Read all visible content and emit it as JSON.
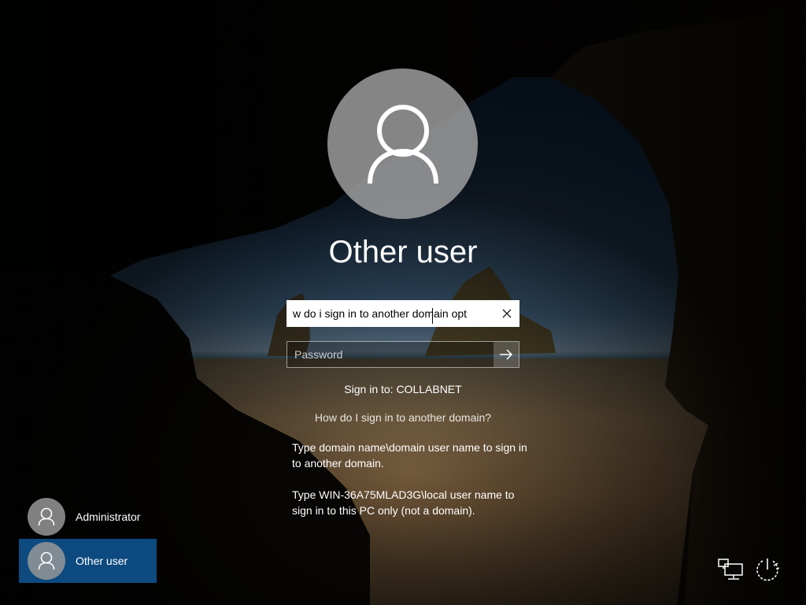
{
  "login": {
    "user_title": "Other user",
    "username_value": "w do i sign in to another domain opt",
    "password_placeholder": "Password",
    "sign_in_to": "Sign in to: COLLABNET",
    "help_link": "How do I sign in to another domain?",
    "help_text_1": "Type domain name\\domain user name to sign in to another domain.",
    "help_text_2": "Type WIN-36A75MLAD3G\\local user name to sign in to this PC only (not a domain).",
    "clear_icon": "close-icon",
    "submit_icon": "arrow-right-icon"
  },
  "users": [
    {
      "label": "Administrator",
      "selected": false,
      "icon": "user-icon"
    },
    {
      "label": "Other user",
      "selected": true,
      "icon": "user-icon"
    }
  ],
  "corner": {
    "network_icon": "network-icon",
    "power_icon": "power-icon"
  },
  "colors": {
    "selected_tile": "#0c4a80",
    "avatar_circle": "#aaaaaa",
    "text": "#ffffff"
  }
}
